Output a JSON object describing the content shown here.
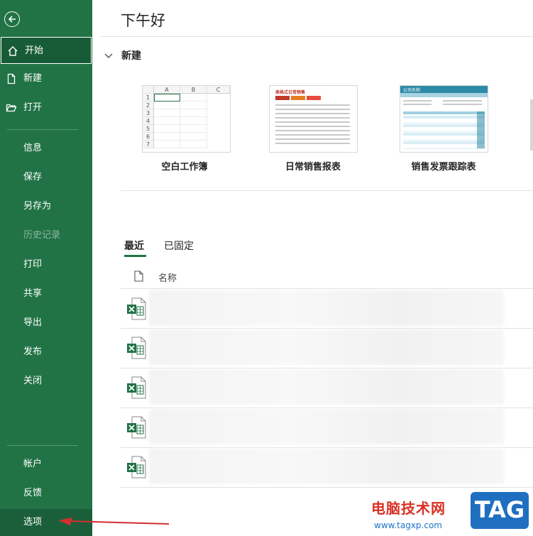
{
  "sidebar": {
    "items": [
      {
        "label": "开始",
        "icon": "home-icon",
        "state": "active"
      },
      {
        "label": "新建",
        "icon": "new-file-icon"
      },
      {
        "label": "打开",
        "icon": "open-folder-icon"
      },
      {
        "label": "信息"
      },
      {
        "label": "保存"
      },
      {
        "label": "另存为"
      },
      {
        "label": "历史记录",
        "state": "disabled"
      },
      {
        "label": "打印"
      },
      {
        "label": "共享"
      },
      {
        "label": "导出"
      },
      {
        "label": "发布"
      },
      {
        "label": "关闭"
      },
      {
        "label": "帐户"
      },
      {
        "label": "反馈"
      },
      {
        "label": "选项"
      }
    ]
  },
  "main": {
    "greeting": "下午好",
    "new_section": {
      "title": "新建",
      "templates": [
        {
          "label": "空白工作簿",
          "thumb_header": "A B C",
          "rows": [
            "1",
            "2",
            "3",
            "4",
            "5",
            "6",
            "7"
          ]
        },
        {
          "label": "日常销售报表",
          "thumb_title": "表格式日常销售"
        },
        {
          "label": "销售发票跟踪表",
          "thumb_title": "公司名称"
        }
      ],
      "blank_columns": [
        "A",
        "B",
        "C"
      ]
    },
    "tabs": [
      {
        "label": "最近",
        "active": true
      },
      {
        "label": "已固定",
        "active": false
      }
    ],
    "list": {
      "column_name": "名称",
      "row_count": 5
    }
  },
  "watermark": {
    "cn": "电脑技术网",
    "url": "www.tagxp.com",
    "tag": "TAG"
  },
  "colors": {
    "sidebar": "#217346",
    "sidebar_active": "#185c37",
    "accent": "#217346"
  }
}
